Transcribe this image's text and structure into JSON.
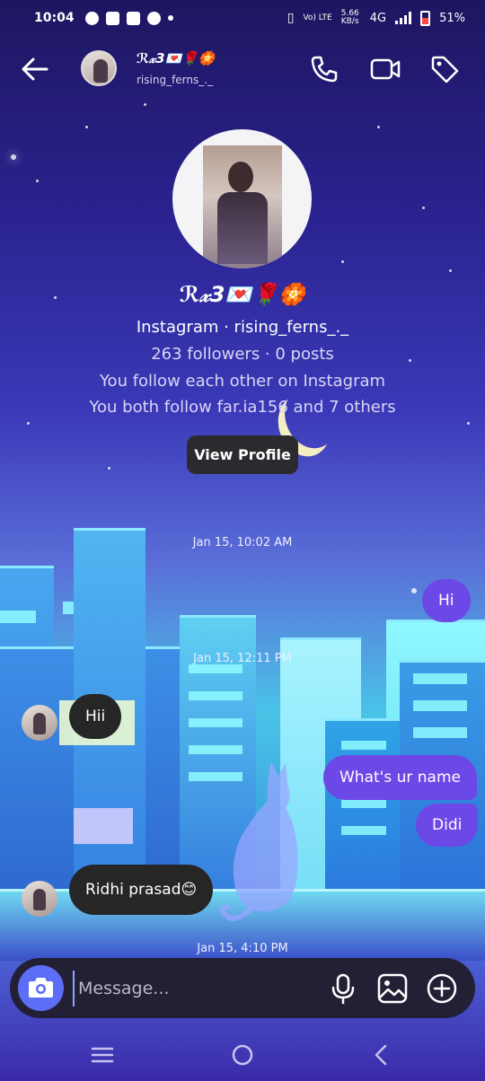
{
  "status_bar": {
    "time": "10:04",
    "network_label": "4G",
    "speed": "5.66 KB/s",
    "battery": "51%"
  },
  "header": {
    "name": "ℛ𝓍3💌🌹🏵️",
    "username": "rising_ferns_._"
  },
  "profile": {
    "name": "ℛ𝓍3💌🌹🏵️",
    "line1": "Instagram · rising_ferns_._",
    "line2": "263 followers · 0 posts",
    "line3": "You follow each other on Instagram",
    "line4": "You both follow far.ia156 and 7 others",
    "view_profile": "View Profile"
  },
  "messages": [
    {
      "type": "timestamp",
      "text": "Jan 15, 10:02 AM"
    },
    {
      "type": "sent",
      "text": "Hi"
    },
    {
      "type": "timestamp",
      "text": "Jan 15, 12:11 PM"
    },
    {
      "type": "received",
      "text": "Hii"
    },
    {
      "type": "sent",
      "text": "What's ur name"
    },
    {
      "type": "sent",
      "text": "Didi"
    },
    {
      "type": "received",
      "text": "Ridhi prasad😊"
    },
    {
      "type": "timestamp",
      "text": "Jan 15, 4:10 PM"
    }
  ],
  "composer": {
    "placeholder": "Message..."
  },
  "icons": {
    "back": "arrow-left-icon",
    "call": "phone-icon",
    "video": "video-camera-icon",
    "tag": "tag-icon",
    "camera": "camera-icon",
    "mic": "microphone-icon",
    "gallery": "image-icon",
    "plus": "plus-circle-icon"
  },
  "colors": {
    "sent_bubble": "#6c48e6",
    "received_bubble": "#262626",
    "camera_button": "#5b6ef5"
  }
}
